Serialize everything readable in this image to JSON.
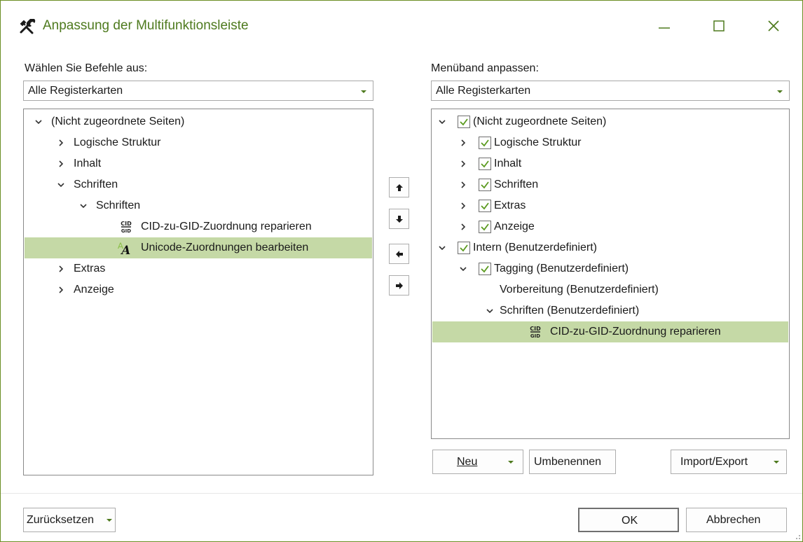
{
  "window": {
    "title": "Anpassung der Multifunktionsleiste",
    "accent_color": "#4e7a1e",
    "selection_color": "#c5d9a6"
  },
  "left": {
    "label": "Wählen Sie Befehle aus:",
    "combo_value": "Alle Registerkarten",
    "tree": [
      {
        "text": "(Nicht zugeordnete Seiten)",
        "state": "expanded",
        "icon": null
      },
      {
        "text": "Logische Struktur",
        "state": "collapsed",
        "icon": null
      },
      {
        "text": "Inhalt",
        "state": "collapsed",
        "icon": null
      },
      {
        "text": "Schriften",
        "state": "expanded",
        "icon": null
      },
      {
        "text": "Schriften",
        "state": "expanded",
        "icon": null
      },
      {
        "text": "CID-zu-GID-Zuordnung reparieren",
        "state": "leaf",
        "icon": "cid-gid-icon"
      },
      {
        "text": "Unicode-Zuordnungen bearbeiten",
        "state": "leaf",
        "icon": "unicode-font-icon",
        "selected": true
      },
      {
        "text": "Extras",
        "state": "collapsed",
        "icon": null
      },
      {
        "text": "Anzeige",
        "state": "collapsed",
        "icon": null
      }
    ]
  },
  "middle": {
    "buttons": [
      "move-up-icon",
      "move-down-icon",
      "remove-arrow-icon",
      "add-arrow-icon"
    ]
  },
  "right": {
    "label": "Menüband anpassen:",
    "combo_value": "Alle Registerkarten",
    "tree": [
      {
        "text": "(Nicht zugeordnete Seiten)",
        "state": "expanded",
        "checked": true
      },
      {
        "text": "Logische Struktur",
        "state": "collapsed",
        "checked": true
      },
      {
        "text": "Inhalt",
        "state": "collapsed",
        "checked": true
      },
      {
        "text": "Schriften",
        "state": "collapsed",
        "checked": true
      },
      {
        "text": "Extras",
        "state": "collapsed",
        "checked": true
      },
      {
        "text": "Anzeige",
        "state": "collapsed",
        "checked": true
      },
      {
        "text": "Intern (Benutzerdefiniert)",
        "state": "expanded",
        "checked": true
      },
      {
        "text": "Tagging (Benutzerdefiniert)",
        "state": "expanded",
        "checked": true
      },
      {
        "text": "Vorbereitung (Benutzerdefiniert)",
        "state": "leaf",
        "checked": null
      },
      {
        "text": "Schriften (Benutzerdefiniert)",
        "state": "expanded",
        "checked": null
      },
      {
        "text": "CID-zu-GID-Zuordnung reparieren",
        "state": "leaf",
        "icon": "cid-gid-icon",
        "selected": true
      }
    ],
    "new_label": "Neu",
    "rename_label": "Umbenennen",
    "import_export_label": "Import/Export"
  },
  "footer": {
    "reset_label": "Zurücksetzen",
    "ok_label": "OK",
    "cancel_label": "Abbrechen"
  }
}
